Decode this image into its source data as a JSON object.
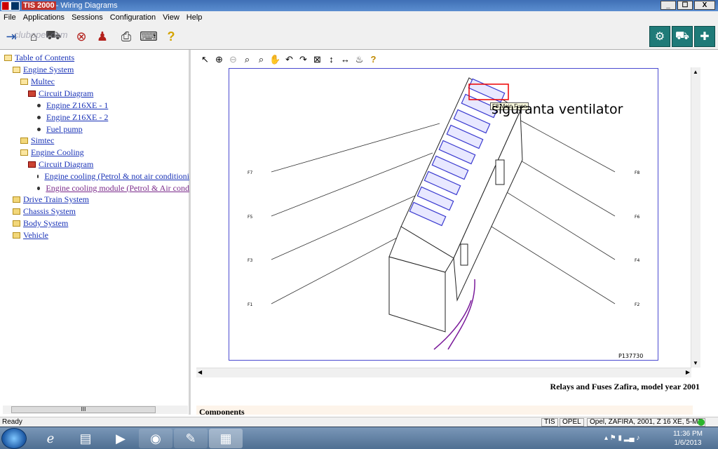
{
  "window": {
    "app_name": "TIS 2000",
    "title_rest": " - Wiring Diagrams",
    "minimize": "_",
    "maximize": "☐",
    "close": "X"
  },
  "menu": [
    "File",
    "Applications",
    "Sessions",
    "Configuration",
    "View",
    "Help"
  ],
  "toolbar": {
    "icons": [
      "exit-icon",
      "home-icon",
      "car-icon",
      "stop-icon",
      "person-icon",
      "printer-icon",
      "keyboard-icon",
      "help-icon"
    ],
    "right_icons": [
      "diagnostics-icon",
      "vehicle-icon",
      "service-icon"
    ],
    "watermark": "clubopel.com"
  },
  "tree": [
    {
      "label": "Table of Contents",
      "icon": "folder-open"
    },
    {
      "label": "Engine System",
      "icon": "folder-open"
    },
    {
      "label": "Multec",
      "icon": "folder-open"
    },
    {
      "label": "Circuit Diagram",
      "icon": "book"
    },
    {
      "label": "Engine Z16XE - 1",
      "icon": "bullet"
    },
    {
      "label": "Engine Z16XE - 2",
      "icon": "bullet"
    },
    {
      "label": "Fuel pump",
      "icon": "bullet"
    },
    {
      "label": "Simtec",
      "icon": "folder"
    },
    {
      "label": "Engine Cooling",
      "icon": "folder-open"
    },
    {
      "label": "Circuit Diagram",
      "icon": "book"
    },
    {
      "label": "Engine cooling (Petrol & not air conditioni",
      "icon": "bullet"
    },
    {
      "label": "Engine cooling module (Petrol & Air cond",
      "icon": "bullet"
    },
    {
      "label": "Drive Train System",
      "icon": "folder"
    },
    {
      "label": "Chassis System",
      "icon": "folder"
    },
    {
      "label": "Body System",
      "icon": "folder"
    },
    {
      "label": "Vehicle",
      "icon": "folder"
    }
  ],
  "left_scrollbar_thumb": "III",
  "viewer_tools": [
    "select-icon",
    "zoom-in-icon",
    "zoom-out-icon",
    "zoom-icon",
    "zoom-area-icon",
    "pan-icon",
    "rotate-left-icon",
    "rotate-right-icon",
    "fit-icon",
    "fit-height-icon",
    "fit-width-icon",
    "layers-icon",
    "help-icon"
  ],
  "diagram": {
    "labels_left": [
      "F7",
      "F5",
      "F3",
      "F1"
    ],
    "labels_right": [
      "F8",
      "F6",
      "F4",
      "F2"
    ],
    "tooltip": "F8 Main Fuse",
    "annotation": "siguranta ventilator",
    "ref": "P137730"
  },
  "caption": "Relays and Fuses Zafira, model year 2001",
  "components_heading": "Components",
  "status": {
    "text": "Ready",
    "cells": [
      "TIS",
      "OPEL",
      "Opel, ZAFIRA, 2001, Z 16 XE, 5-MT"
    ]
  },
  "taskbar": {
    "apps": [
      "ie-icon",
      "explorer-icon",
      "media-player-icon",
      "chrome-icon",
      "acrobat-icon",
      "tis-icon"
    ],
    "time": "11:36 PM",
    "date": "1/6/2013"
  }
}
